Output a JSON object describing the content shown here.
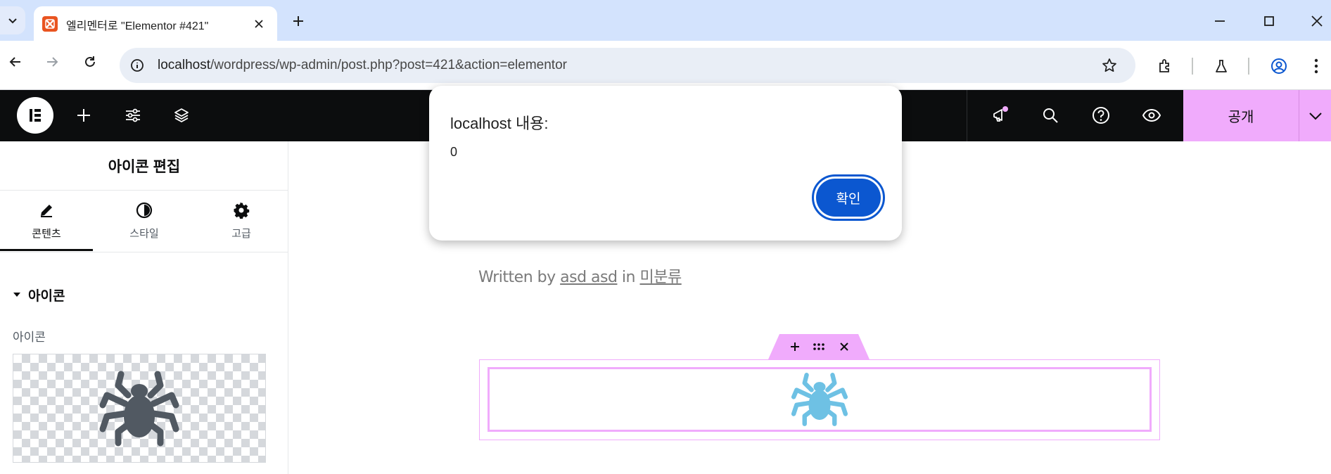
{
  "browser": {
    "tab_title": "엘리멘터로 \"Elementor #421\"",
    "url_host": "localhost",
    "url_path": "/wordpress/wp-admin/post.php?post=421&action=elementor",
    "icons": [
      "tab-search-icon",
      "elementor-favicon",
      "close-tab-icon",
      "new-tab-icon",
      "minimize-icon",
      "maximize-icon",
      "close-window-icon",
      "back-icon",
      "forward-icon",
      "reload-icon",
      "site-info-icon",
      "bookmark-star-icon",
      "extensions-icon",
      "labs-icon",
      "profile-icon",
      "menu-dots-icon"
    ]
  },
  "editor": {
    "publish_label": "공개",
    "accent": "#f0abfc"
  },
  "panel": {
    "title": "아이콘 편집",
    "tabs": [
      {
        "label": "콘텐츠",
        "icon": "pencil-icon"
      },
      {
        "label": "스타일",
        "icon": "contrast-icon"
      },
      {
        "label": "고급",
        "icon": "gear-icon"
      }
    ],
    "section_title": "아이콘",
    "field_label": "아이콘",
    "icon_name": "spider-icon"
  },
  "canvas": {
    "byline_prefix": "Written by ",
    "author": "asd asd",
    "byline_in": " in ",
    "category": "미분류",
    "widget_icon": "spider-icon",
    "widget_icon_color": "#6ec1e4"
  },
  "dialog": {
    "title": "localhost 내용:",
    "message": "0",
    "ok_label": "확인",
    "ok_color": "#0b57d0"
  }
}
